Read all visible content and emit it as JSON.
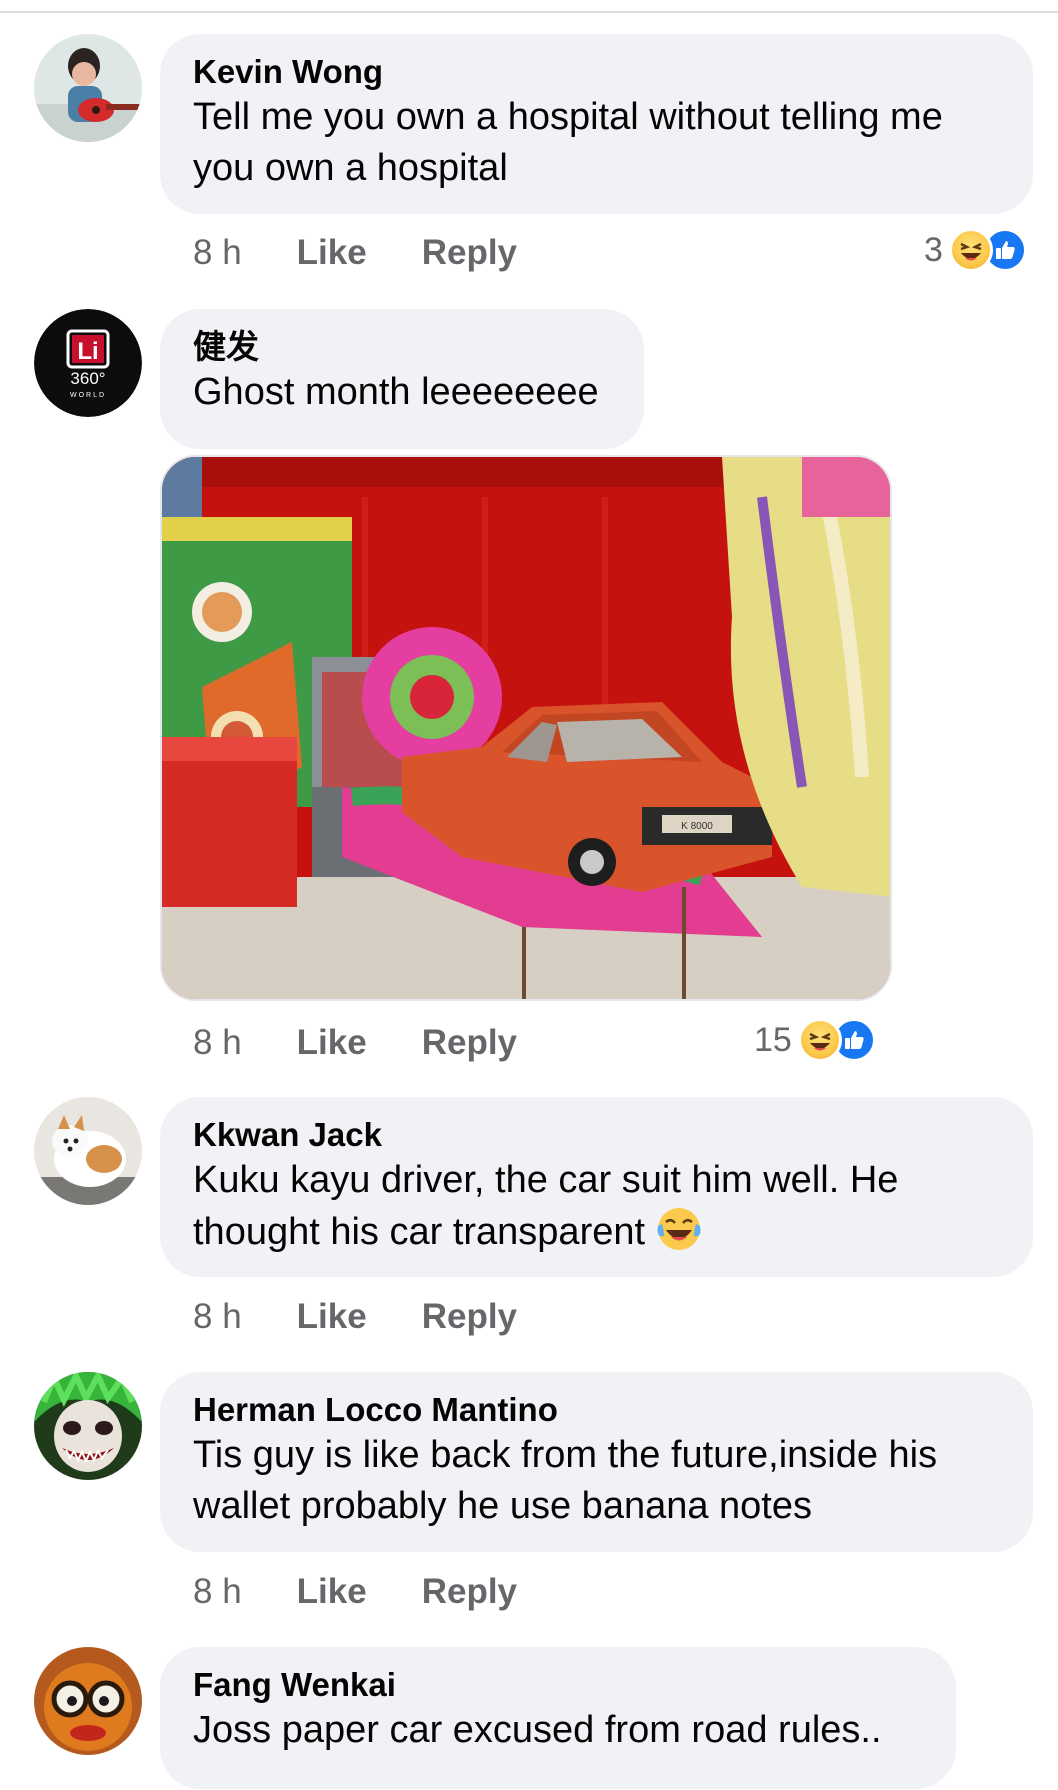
{
  "comments": [
    {
      "author": "Kevin Wong",
      "text": "Tell me you own a hospital without telling me you own a hospital",
      "time": "8 h",
      "like_label": "Like",
      "reply_label": "Reply",
      "reaction_count": "3",
      "reactions": [
        "haha",
        "like"
      ]
    },
    {
      "author": "健发",
      "text": "Ghost month leeeeeeee",
      "time": "8 h",
      "like_label": "Like",
      "reply_label": "Reply",
      "reaction_count": "15",
      "reactions": [
        "haha",
        "like"
      ],
      "avatar_logo": {
        "line1": "Li",
        "line2": "360°",
        "line3": "WORLD"
      },
      "photo_plate": "K 8000"
    },
    {
      "author": "Kkwan Jack",
      "text_line1": "Kuku kayu driver, the car suit him well. He",
      "text_line2": "thought his car transparent",
      "text_emoji": "face-with-tears-of-joy",
      "time": "8 h",
      "like_label": "Like",
      "reply_label": "Reply"
    },
    {
      "author": "Herman Locco Mantino",
      "text": "Tis guy is like back from the future,inside his wallet probably he use banana notes",
      "time": "8 h",
      "like_label": "Like",
      "reply_label": "Reply"
    },
    {
      "author": "Fang Wenkai",
      "text": "Joss paper car excused from road rules.."
    }
  ],
  "colors": {
    "bubble": "#f0f2f5",
    "meta_text": "#65676b",
    "like_blue": "#1877f2",
    "haha_yellow": "#fbc94b"
  }
}
